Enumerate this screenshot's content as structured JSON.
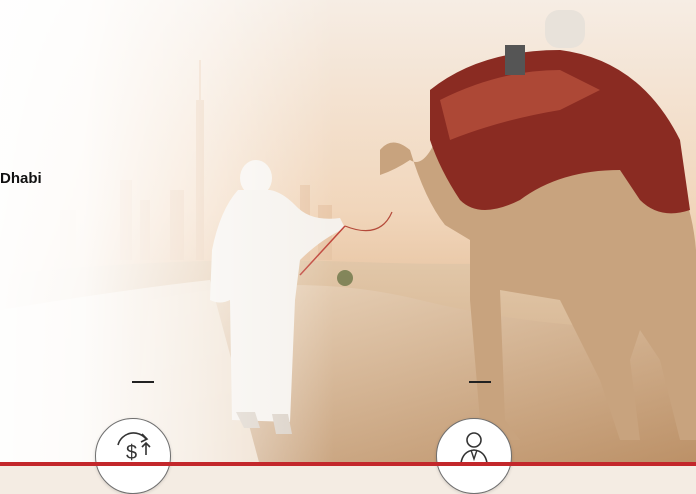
{
  "hero": {
    "title_fragment": "Dhabi"
  },
  "features": [
    {
      "icon": "money-exchange-icon"
    },
    {
      "icon": "businessman-icon"
    }
  ],
  "colors": {
    "accent_bar": "#c3272b",
    "title_text": "#111111"
  }
}
